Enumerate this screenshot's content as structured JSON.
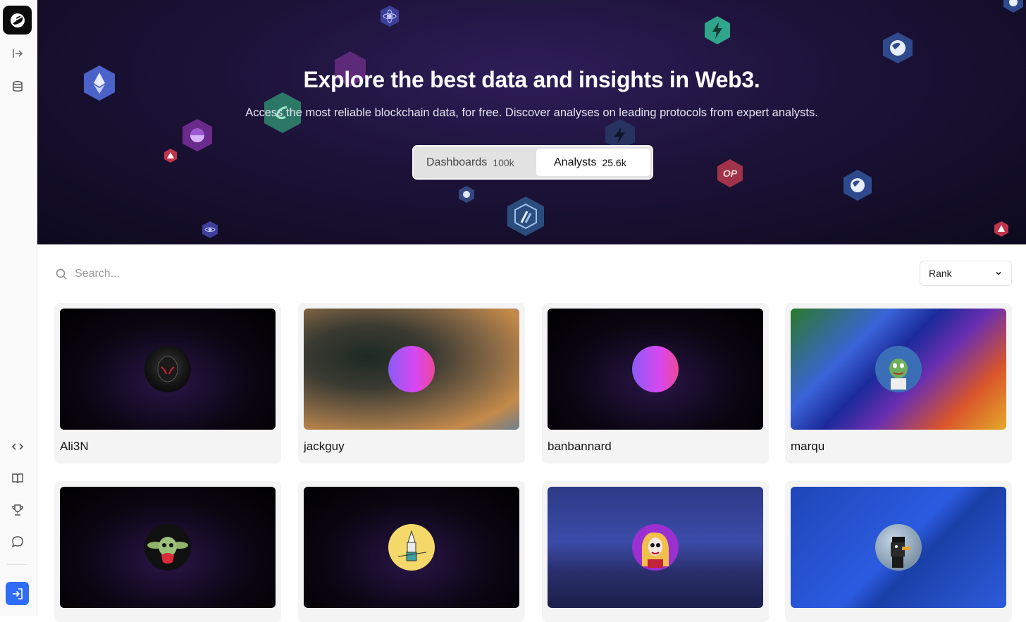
{
  "sidebar": {
    "logo": "dune-logo-icon",
    "icons": [
      "expand-sidebar-icon",
      "database-icon",
      "code-icon",
      "book-icon",
      "trophy-icon",
      "chat-icon",
      "login-icon"
    ]
  },
  "hero": {
    "title": "Explore the best data and insights in Web3.",
    "subtitle": "Access the most reliable blockchain data, for free. Discover analyses on leading protocols from expert analysts.",
    "tabs": [
      {
        "label": "Dashboards",
        "count": "100k",
        "active": false
      },
      {
        "label": "Analysts",
        "count": "25.6k",
        "active": true
      }
    ]
  },
  "search": {
    "placeholder": "Search..."
  },
  "sort": {
    "label": "Rank"
  },
  "analysts": [
    {
      "name": "Ali3N"
    },
    {
      "name": "jackguy"
    },
    {
      "name": "banbannard"
    },
    {
      "name": "marqu"
    },
    {
      "name": ""
    },
    {
      "name": ""
    },
    {
      "name": ""
    },
    {
      "name": ""
    }
  ],
  "colors": {
    "accent": "#2f6df6",
    "hero_bg": "#1c1238",
    "card_bg": "#f4f4f4"
  }
}
